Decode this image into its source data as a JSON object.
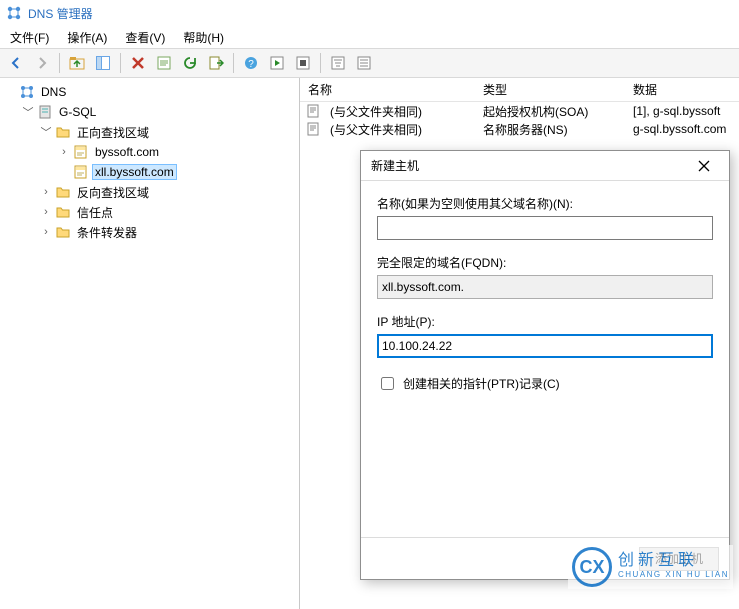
{
  "title": "DNS 管理器",
  "menu": {
    "file": "文件(F)",
    "action": "操作(A)",
    "view": "查看(V)",
    "help": "帮助(H)"
  },
  "tree": {
    "root": "DNS",
    "server": "G-SQL",
    "forward_zone": "正向查找区域",
    "zone1": "byssoft.com",
    "zone2": "xll.byssoft.com",
    "reverse_zone": "反向查找区域",
    "trust_points": "信任点",
    "cond_forwarders": "条件转发器"
  },
  "columns": {
    "name": "名称",
    "type": "类型",
    "data": "数据"
  },
  "rows": [
    {
      "name": "(与父文件夹相同)",
      "type": "起始授权机构(SOA)",
      "data": "[1], g-sql.byssoft"
    },
    {
      "name": "(与父文件夹相同)",
      "type": "名称服务器(NS)",
      "data": "g-sql.byssoft.com"
    }
  ],
  "dialog": {
    "title": "新建主机",
    "name_label": "名称(如果为空则使用其父域名称)(N):",
    "name_value": "",
    "fqdn_label": "完全限定的域名(FQDN):",
    "fqdn_value": "xll.byssoft.com.",
    "ip_label": "IP 地址(P):",
    "ip_value": "10.100.24.22",
    "ptr_label": "创建相关的指针(PTR)记录(C)",
    "add_btn": "添加主机"
  },
  "watermark": {
    "big": "创新互联",
    "small": "CHUANG XIN HU LIAN",
    "mark": "CX"
  }
}
